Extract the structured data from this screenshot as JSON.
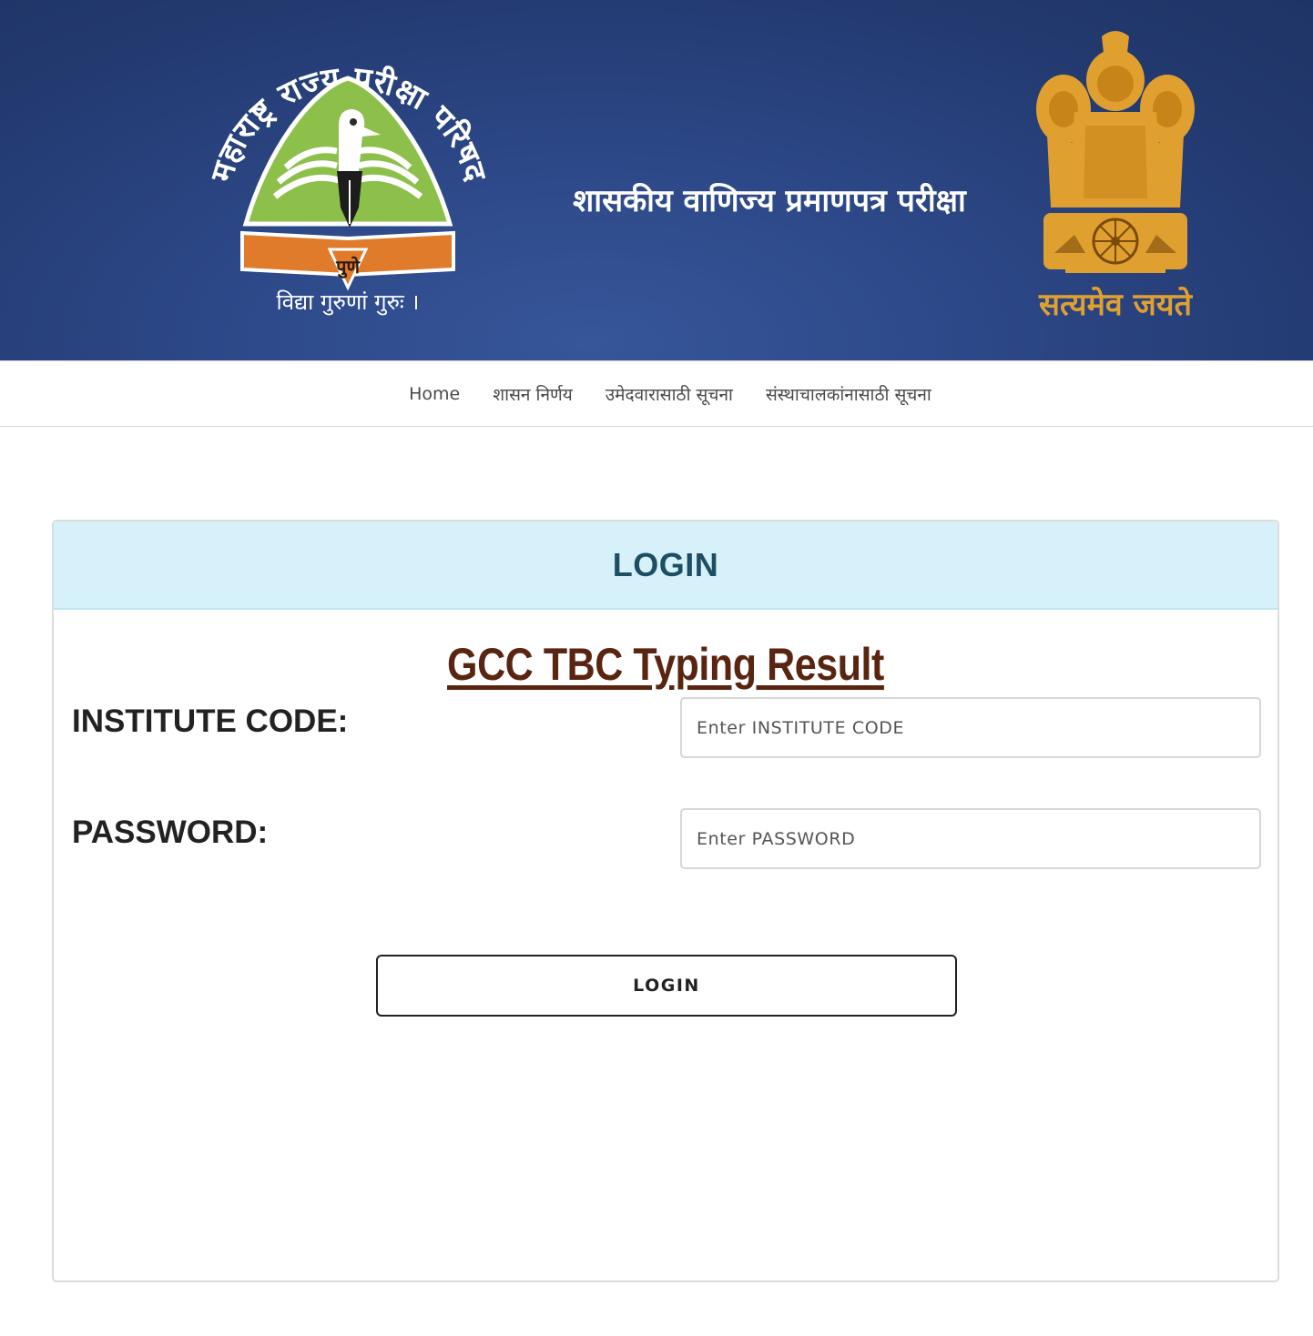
{
  "header": {
    "title": "शासकीय वाणिज्य प्रमाणपत्र परीक्षा",
    "left_logo": {
      "arc_text": "महाराष्ट्र राज्य परीक्षा परिषद",
      "city": "पुणे",
      "motto": "विद्या गुरुणां गुरुः ।",
      "icon": "msce-emblem-icon"
    },
    "right_logo": {
      "motto": "सत्यमेव जयते",
      "icon": "lion-capital-emblem-icon"
    },
    "colors": {
      "banner": "#2c4786",
      "gold": "#e0a030",
      "green": "#8dc04a",
      "orange": "#e07b2c"
    }
  },
  "nav": {
    "items": [
      {
        "label": "Home"
      },
      {
        "label": "शासन निर्णय"
      },
      {
        "label": "उमेदवारासाठी सूचना"
      },
      {
        "label": "संस्थाचालकांनासाठी सूचना"
      }
    ]
  },
  "panel": {
    "heading": "LOGIN",
    "subtitle": "GCC TBC Typing Result",
    "institute_label": "INSTITUTE CODE:",
    "institute_placeholder": "Enter INSTITUTE CODE",
    "institute_value": "",
    "password_label": "PASSWORD:",
    "password_placeholder": "Enter PASSWORD",
    "password_value": "",
    "button_label": "LOGIN",
    "colors": {
      "heading_bg": "#d6f1f9",
      "heading_text": "#1e4e63",
      "subtitle": "#5a2510"
    }
  }
}
